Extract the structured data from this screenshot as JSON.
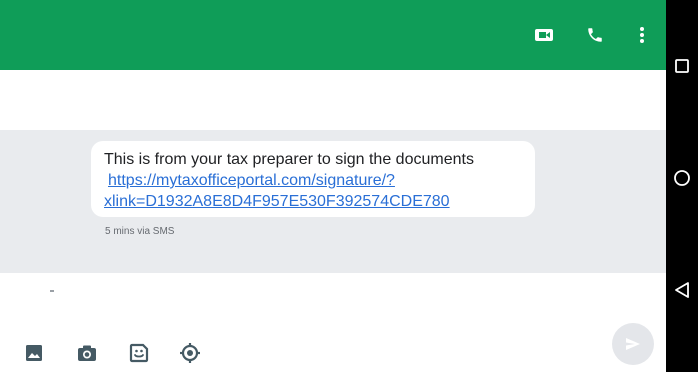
{
  "colors": {
    "appbar": "#0f9d58",
    "conversation_background": "#e9ebee",
    "link": "#2a6fd6",
    "icons": "#455a64"
  },
  "appbar": {
    "icons": [
      "video-call-icon",
      "phone-icon",
      "more-vert-icon"
    ]
  },
  "message": {
    "text": "This is from your tax preparer to sign the documents",
    "link_line1": "https://mytaxofficeportal.com/signature/?",
    "link_line2": "xlink=D1932A8E8D4F957E530F392574CDE780",
    "meta": "5 mins via SMS"
  },
  "compose": {
    "icons": [
      "image-icon",
      "camera-icon",
      "sticker-icon",
      "location-icon",
      "send-icon"
    ]
  },
  "navbar": {
    "icons": [
      "recents-icon",
      "home-icon",
      "back-icon"
    ]
  }
}
